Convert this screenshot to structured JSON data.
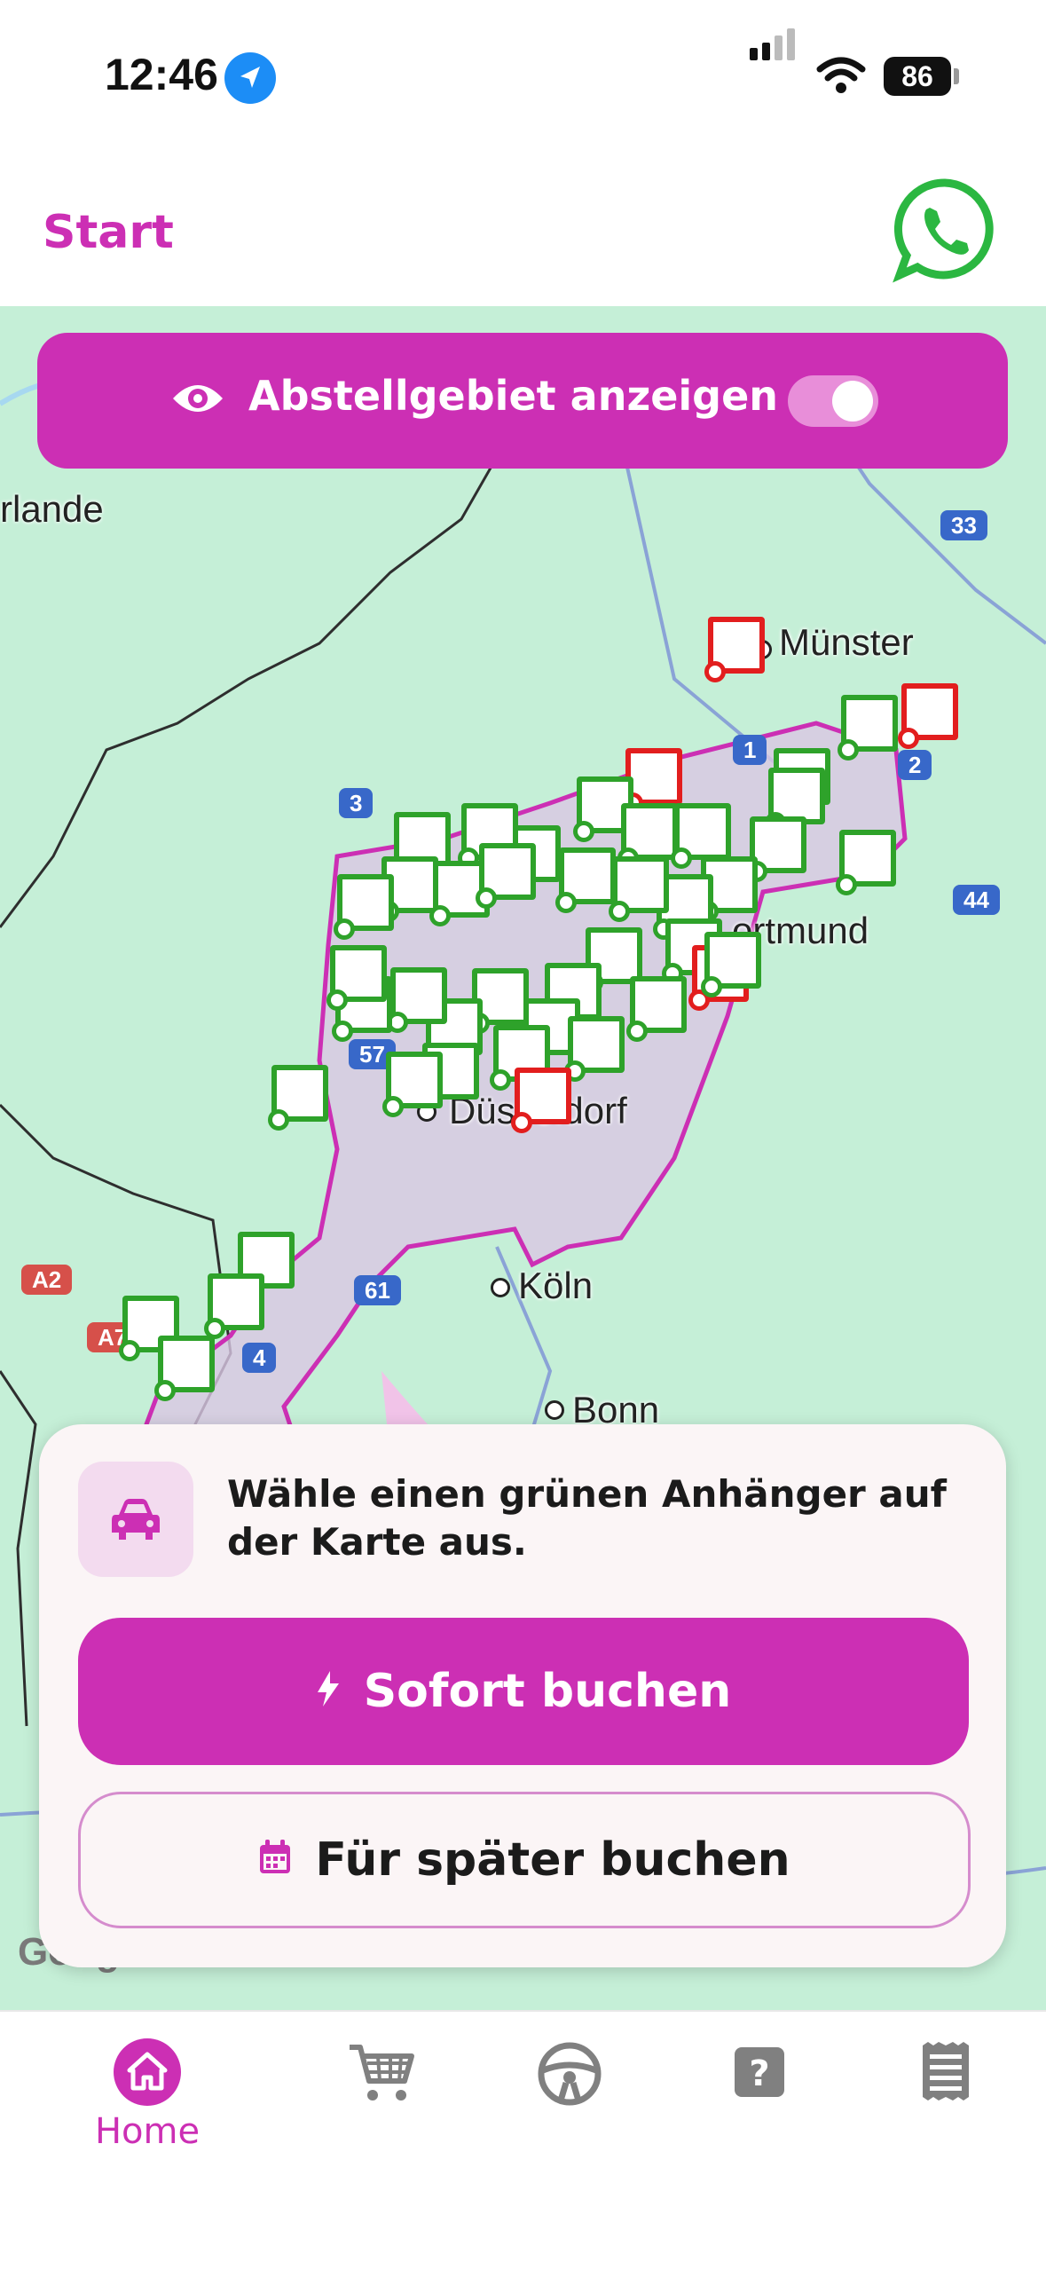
{
  "status": {
    "time": "12:46",
    "battery": "86"
  },
  "header": {
    "start_label": "Start"
  },
  "map_overlay": {
    "toggle_label": "Abstellgebiet anzeigen",
    "toggle_on": true
  },
  "map": {
    "cities": [
      "Münster",
      "ortmund",
      "Düsseldorf",
      "Köln",
      "Bonn",
      "rlande"
    ],
    "road_shields": [
      "1",
      "2",
      "3",
      "33",
      "44",
      "57",
      "61",
      "4",
      "A2",
      "A7"
    ],
    "attribution": "Google"
  },
  "booking_card": {
    "message": "Wähle einen grünen Anhänger auf der Karte aus.",
    "primary_button": "Sofort buchen",
    "secondary_button": "Für später buchen"
  },
  "tabbar": {
    "home_label": "Home"
  },
  "colors": {
    "accent": "#cc2fb4",
    "available": "#2ea22a",
    "unavailable": "#e21e1e"
  }
}
